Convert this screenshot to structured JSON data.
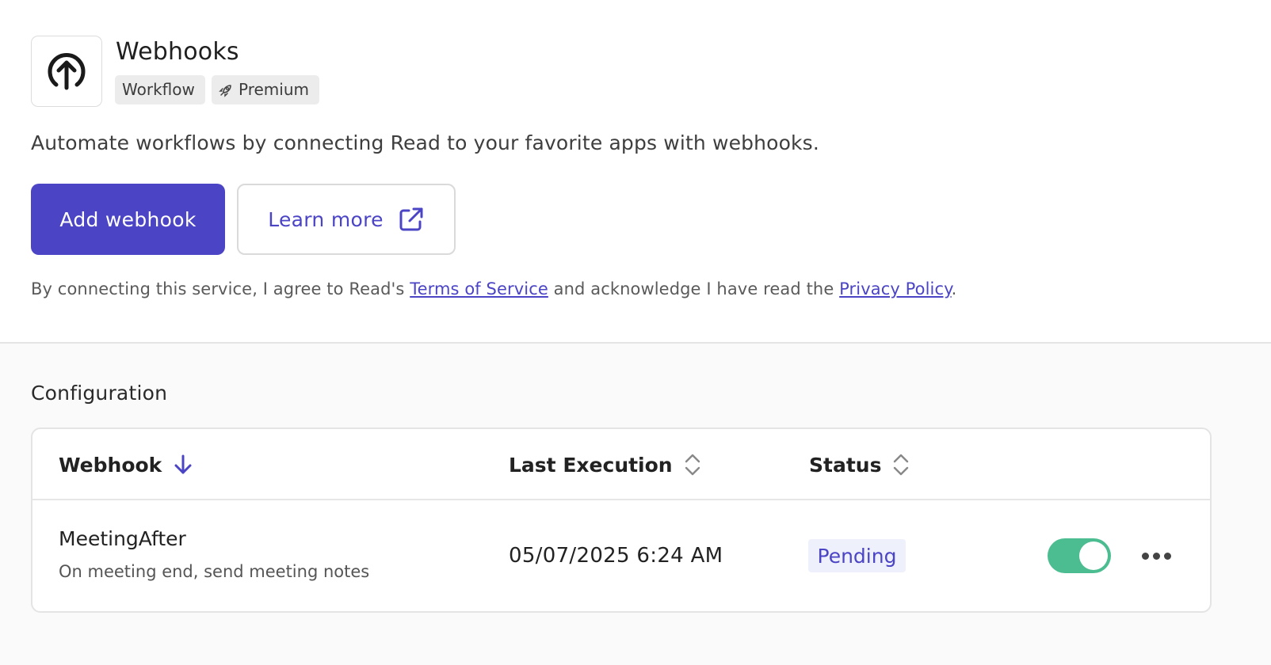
{
  "header": {
    "title": "Webhooks",
    "logo_icon": "upload-circle-icon",
    "badges": [
      {
        "label": "Workflow"
      },
      {
        "label": "Premium",
        "icon": "rocket-icon"
      }
    ]
  },
  "description": "Automate workflows by connecting Read to your favorite apps with webhooks.",
  "actions": {
    "add_label": "Add webhook",
    "learn_label": "Learn more",
    "learn_icon": "external-link-icon"
  },
  "consent": {
    "prefix": "By connecting this service, I agree to Read's ",
    "terms_link": "Terms of Service",
    "middle": " and acknowledge I have read the ",
    "privacy_link": "Privacy Policy",
    "suffix": "."
  },
  "configuration": {
    "title": "Configuration",
    "columns": [
      {
        "label": "Webhook",
        "sort": "descending"
      },
      {
        "label": "Last Execution",
        "sort": "none"
      },
      {
        "label": "Status",
        "sort": "none"
      }
    ],
    "rows": [
      {
        "name": "MeetingAfter",
        "description": "On meeting end, send meeting notes",
        "last_execution": "05/07/2025 6:24 AM",
        "status": "Pending",
        "enabled": true
      }
    ]
  },
  "colors": {
    "accent": "#4b45c6",
    "toggle_on": "#4cbd91",
    "status_bg": "#eef0fb"
  }
}
